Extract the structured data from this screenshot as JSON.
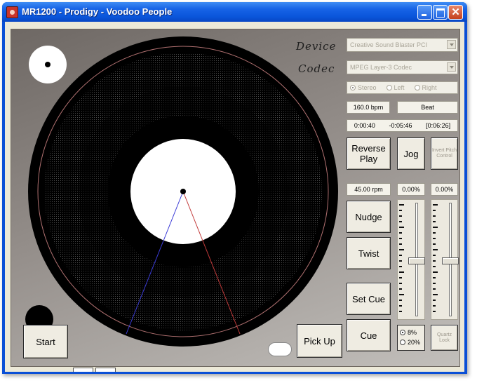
{
  "window": {
    "title": "MR1200 - Prodigy - Voodoo People",
    "close_glyph": "✕"
  },
  "labels": {
    "device": "Device",
    "codec": "Codec"
  },
  "device_select": {
    "value": "Creative Sound Blaster PCI"
  },
  "codec_select": {
    "value": "MPEG Layer-3 Codec"
  },
  "channel_options": [
    {
      "label": "Stereo",
      "selected": true
    },
    {
      "label": "Left",
      "selected": false
    },
    {
      "label": "Right",
      "selected": false
    }
  ],
  "bpm": "160.0 bpm",
  "beat_label": "Beat",
  "time": {
    "elapsed": "0:00:40",
    "remaining": "-0:05:46",
    "total": "[0:06:26]"
  },
  "buttons": {
    "reverse_play": "Reverse Play",
    "jog": "Jog",
    "invert_pitch": "Invert Pitch Control",
    "nudge": "Nudge",
    "twist": "Twist",
    "set_cue": "Set Cue",
    "cue": "Cue",
    "pick_up": "Pick Up",
    "start": "Start",
    "quartz_lock": "Quartz Lock"
  },
  "rpm": "45.00 rpm",
  "pitch_left": {
    "value": "0.00%",
    "position": 0.5
  },
  "pitch_right": {
    "value": "0.00%",
    "position": 0.5
  },
  "pitch_range": [
    {
      "label": "8%",
      "selected": true
    },
    {
      "label": "20%",
      "selected": false
    }
  ],
  "colors": {
    "tonearm_left": "#3b3bd6",
    "tonearm_right": "#c23a3a",
    "label": "#ffffff",
    "rim_ring": "#b07070"
  }
}
